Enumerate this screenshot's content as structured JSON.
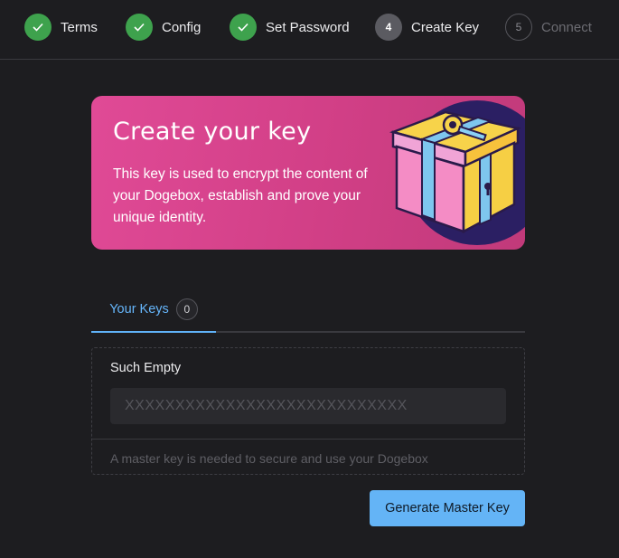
{
  "stepper": {
    "steps": [
      {
        "label": "Terms",
        "state": "done",
        "icon": "check-icon"
      },
      {
        "label": "Config",
        "state": "done",
        "icon": "check-icon"
      },
      {
        "label": "Set Password",
        "state": "done",
        "icon": "check-icon"
      },
      {
        "label": "Create Key",
        "state": "active",
        "number": "4"
      },
      {
        "label": "Connect",
        "state": "pending",
        "number": "5"
      }
    ]
  },
  "hero": {
    "title": "Create your key",
    "description": "This key is used to encrypt the content of your Dogebox, establish and prove your unique identity.",
    "illustration": "gift-box-with-key-illustration"
  },
  "tabs": [
    {
      "label": "Your Keys",
      "count": "0",
      "active": true
    }
  ],
  "keys_panel": {
    "title": "Such Empty",
    "key_placeholder": "XXXXXXXXXXXXXXXXXXXXXXXXXXXX",
    "hint": "A master key is needed to secure and use your Dogebox"
  },
  "actions": {
    "generate_label": "Generate Master Key"
  },
  "colors": {
    "background": "#1d1d20",
    "step_done": "#3ea24d",
    "step_active": "#5b5b61",
    "hero_gradient_start": "#e04a96",
    "hero_gradient_end": "#c13a7a",
    "accent": "#64b4f6"
  }
}
